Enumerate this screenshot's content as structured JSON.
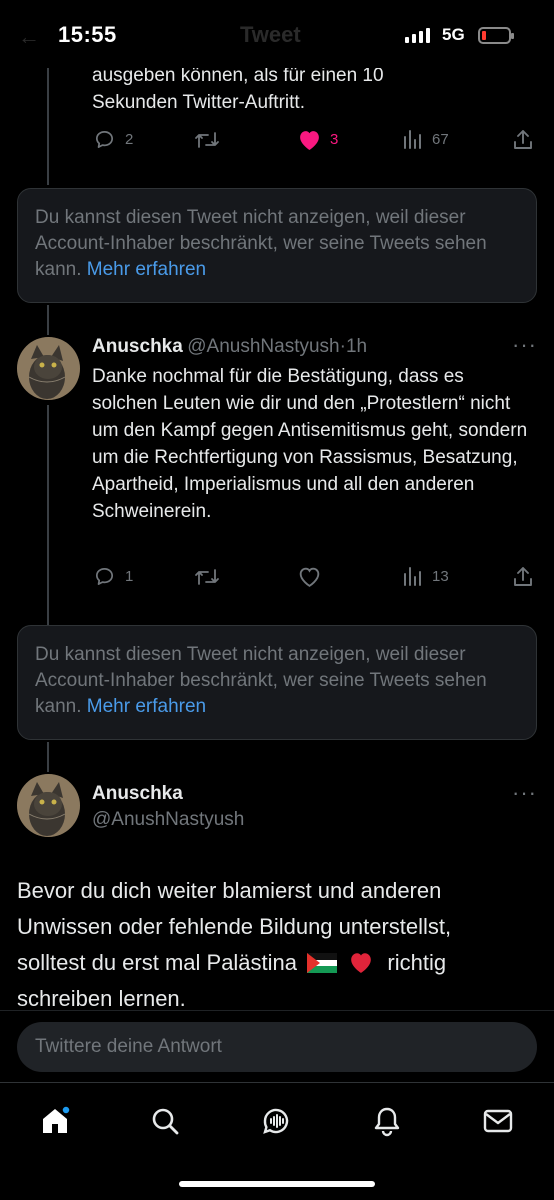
{
  "status": {
    "time": "15:55",
    "network": "5G",
    "header_title": "Tweet"
  },
  "tweet1": {
    "text_line1": "ausgeben können, als für einen 10",
    "text_line2": "Sekunden Twitter-Auftritt.",
    "replies": "2",
    "likes": "3",
    "views": "67",
    "liked": true
  },
  "restricted1": {
    "text": "Du kannst diesen Tweet nicht anzeigen, weil dieser Account-Inhaber beschränkt, wer seine Tweets sehen kann. ",
    "link": "Mehr erfahren"
  },
  "tweet2": {
    "name": "Anuschka",
    "handle": "@AnushNastyush",
    "dot": "·",
    "time": "1h",
    "text": "Danke nochmal für die Bestätigung, dass es solchen Leuten wie dir und den „Protestlern“ nicht um den Kampf gegen Antisemitismus geht, sondern um die Rechtfertigung von Rassismus, Besatzung, Apartheid, Imperialismus und all den anderen Schweinerein.",
    "replies": "1",
    "views": "13"
  },
  "restricted2": {
    "text": "Du kannst diesen Tweet nicht anzeigen, weil dieser Account-Inhaber beschränkt, wer seine Tweets sehen kann. ",
    "link": "Mehr erfahren"
  },
  "main_tweet": {
    "name": "Anuschka",
    "handle": "@AnushNastyush",
    "text_line1": "Bevor du dich weiter blamierst und anderen",
    "text_line2": "Unwissen oder fehlende Bildung unterstellst,",
    "text_line3_a": "solltest du erst mal Palästina",
    "text_line3_b": "richtig",
    "text_line4": "schreiben lernen."
  },
  "reply": {
    "placeholder": "Twittere deine Antwort"
  },
  "colors": {
    "accent": "#1d9bf0",
    "link": "#4a9be9",
    "like": "#f91880",
    "muted": "#71767b"
  }
}
